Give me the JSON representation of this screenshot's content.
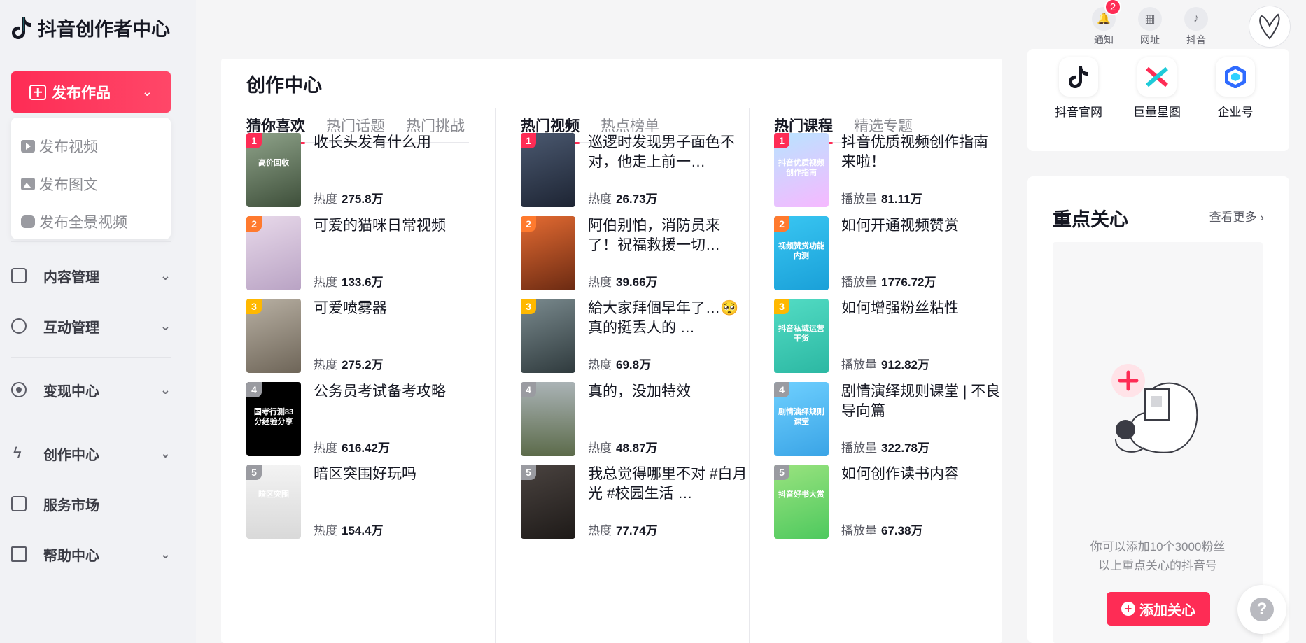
{
  "app": {
    "logo_text": "抖音创作者中心"
  },
  "sidebar": {
    "publish_label": "发布作品",
    "publish_menu": [
      "发布视频",
      "发布图文",
      "发布全景视频"
    ],
    "nav": [
      {
        "label": "内容管理",
        "icon": "play-square-icon",
        "has_chevron": true
      },
      {
        "label": "互动管理",
        "icon": "chat-search-icon",
        "has_chevron": true
      },
      {
        "label": "变现中心",
        "icon": "target-circle-icon",
        "has_chevron": true
      },
      {
        "label": "创作中心",
        "icon": "lightning-icon",
        "has_chevron": true
      },
      {
        "label": "服务市场",
        "icon": "shop-icon",
        "has_chevron": false
      },
      {
        "label": "帮助中心",
        "icon": "book-icon",
        "has_chevron": true
      }
    ]
  },
  "toolbar": {
    "notify_label": "通知",
    "notify_count": "2",
    "sites_label": "网址",
    "douyin_label": "抖音"
  },
  "main": {
    "title": "创作中心",
    "col1": {
      "tabs": [
        "猜你喜欢",
        "热门话题",
        "热门挑战"
      ],
      "items": [
        {
          "rank": "1",
          "title": "收长头发有什么用",
          "meta_label": "热度",
          "meta_value": "275.8万",
          "thumb_text": "高价回收"
        },
        {
          "rank": "2",
          "title": "可爱的猫咪日常视频",
          "meta_label": "热度",
          "meta_value": "133.6万",
          "thumb_text": ""
        },
        {
          "rank": "3",
          "title": "可爱喷雾器",
          "meta_label": "热度",
          "meta_value": "275.2万",
          "thumb_text": ""
        },
        {
          "rank": "4",
          "title": "公务员考试备考攻略",
          "meta_label": "热度",
          "meta_value": "616.42万",
          "thumb_text": "国考行测83分经验分享"
        },
        {
          "rank": "5",
          "title": "暗区突围好玩吗",
          "meta_label": "热度",
          "meta_value": "154.4万",
          "thumb_text": "暗区突围"
        }
      ]
    },
    "col2": {
      "tabs": [
        "热门视频",
        "热点榜单"
      ],
      "items": [
        {
          "rank": "1",
          "title": "巡逻时发现男子面色不对，他走上前一…",
          "meta_label": "热度",
          "meta_value": "26.73万",
          "thumb_text": ""
        },
        {
          "rank": "2",
          "title": "阿伯别怕，消防员来了！祝福救援一切…",
          "meta_label": "热度",
          "meta_value": "39.66万",
          "thumb_text": ""
        },
        {
          "rank": "3",
          "title": "給大家拜個早年了…🥺 真的挺丢人的 …",
          "meta_label": "热度",
          "meta_value": "69.8万",
          "thumb_text": ""
        },
        {
          "rank": "4",
          "title": "真的，没加特效",
          "meta_label": "热度",
          "meta_value": "48.87万",
          "thumb_text": ""
        },
        {
          "rank": "5",
          "title": "我总觉得哪里不对 #白月光 #校园生活 …",
          "meta_label": "热度",
          "meta_value": "77.74万",
          "thumb_text": ""
        }
      ]
    },
    "col3": {
      "tabs": [
        "热门课程",
        "精选专题"
      ],
      "items": [
        {
          "rank": "1",
          "title": "抖音优质视频创作指南来啦！",
          "meta_label": "播放量",
          "meta_value": "81.11万",
          "thumb_text": "抖音优质视频创作指南"
        },
        {
          "rank": "2",
          "title": "如何开通视频赞赏",
          "meta_label": "播放量",
          "meta_value": "1776.72万",
          "thumb_text": "视频赞赏功能内测"
        },
        {
          "rank": "3",
          "title": "如何增强粉丝粘性",
          "meta_label": "播放量",
          "meta_value": "912.82万",
          "thumb_text": "抖音私域运营干货"
        },
        {
          "rank": "4",
          "title": "剧情演绎规则课堂 | 不良导向篇",
          "meta_label": "播放量",
          "meta_value": "322.78万",
          "thumb_text": "剧情演绎规则课堂"
        },
        {
          "rank": "5",
          "title": "如何创作读书内容",
          "meta_label": "播放量",
          "meta_value": "67.38万",
          "thumb_text": "抖音好书大赏"
        }
      ]
    }
  },
  "right": {
    "apps": [
      {
        "label": "抖音官网",
        "icon": "douyin-logo-icon"
      },
      {
        "label": "巨量星图",
        "icon": "star-map-icon"
      },
      {
        "label": "企业号",
        "icon": "enterprise-cube-icon"
      }
    ],
    "focus": {
      "title": "重点关心",
      "more": "查看更多",
      "desc_line1": "你可以添加10个3000粉丝",
      "desc_line2": "以上重点关心的抖音号",
      "add_label": "添加关心"
    }
  },
  "colors": {
    "accent": "#fe2c55",
    "rank1": "#fe2c55",
    "rank2": "#ff7a2e",
    "rank3": "#ffb800",
    "rank_other": "#9a9ba1"
  }
}
